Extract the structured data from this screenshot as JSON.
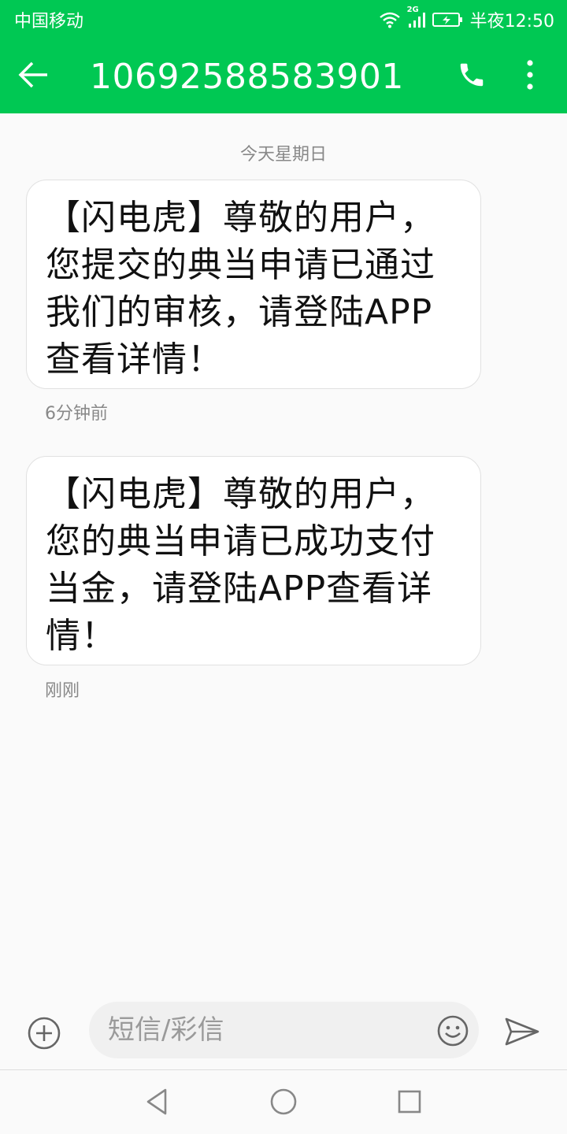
{
  "status_bar": {
    "carrier": "中国移动",
    "network": "2G",
    "time": "半夜12:50"
  },
  "app_bar": {
    "title": "10692588583901",
    "icons": {
      "back": "arrow-back-icon",
      "call": "phone-icon",
      "more": "more-vert-icon"
    }
  },
  "conversation": {
    "date_label": "今天星期日",
    "messages": [
      {
        "text": "【闪电虎】尊敬的用户，您提交的典当申请已通过我们的审核，请登陆APP查看详情！",
        "time": "6分钟前"
      },
      {
        "text": "【闪电虎】尊敬的用户，您的典当申请已成功支付当金，请登陆APP查看详情！",
        "time": "刚刚"
      }
    ]
  },
  "composer": {
    "placeholder": "短信/彩信",
    "icons": {
      "add": "add-circle-icon",
      "emoji": "emoji-icon",
      "send": "send-icon"
    }
  },
  "nav_bar": {
    "icons": {
      "back": "nav-back-icon",
      "home": "nav-home-icon",
      "recent": "nav-recent-icon"
    }
  },
  "colors": {
    "accent": "#00c853",
    "bubble_bg": "#ffffff",
    "background": "#fafafa"
  }
}
